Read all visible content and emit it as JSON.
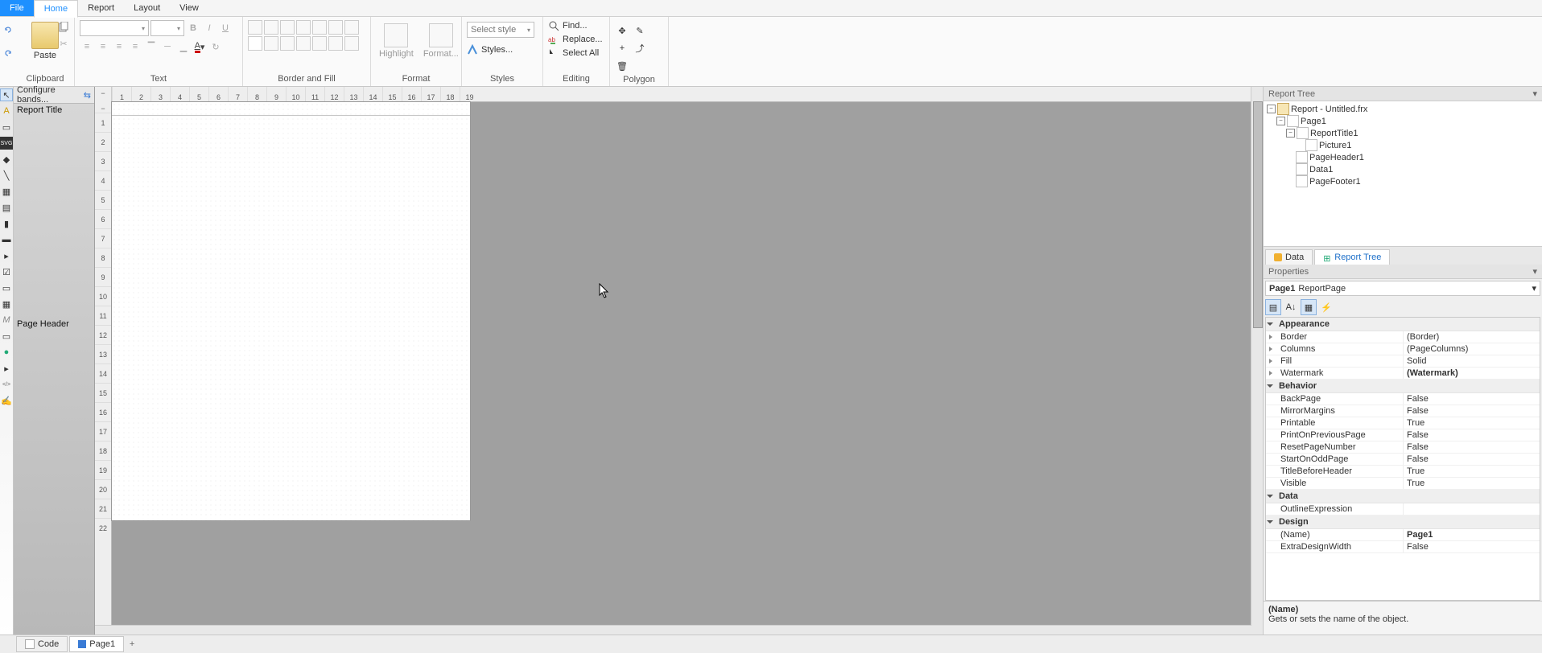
{
  "menu": {
    "file": "File",
    "home": "Home",
    "report": "Report",
    "layout": "Layout",
    "view": "View"
  },
  "ribbon": {
    "clipboard": {
      "paste": "Paste",
      "label": "Clipboard"
    },
    "text": {
      "label": "Text"
    },
    "border": {
      "label": "Border and Fill"
    },
    "format": {
      "highlight": "Highlight",
      "format": "Format...",
      "label": "Format"
    },
    "styles": {
      "combo": "Select style",
      "styles": "Styles...",
      "label": "Styles"
    },
    "editing": {
      "find": "Find...",
      "replace": "Replace...",
      "selectall": "Select All",
      "label": "Editing"
    },
    "polygon": {
      "label": "Polygon"
    }
  },
  "bands": {
    "configure": "Configure bands...",
    "title": "Report Title",
    "header": "Page Header"
  },
  "ruler_h": [
    "1",
    "2",
    "3",
    "4",
    "5",
    "6",
    "7",
    "8",
    "9",
    "10",
    "11",
    "12",
    "13",
    "14",
    "15",
    "16",
    "17",
    "18",
    "19"
  ],
  "ruler_v": [
    "1",
    "2",
    "3",
    "4",
    "5",
    "6",
    "7",
    "8",
    "9",
    "10",
    "11",
    "12",
    "13",
    "14",
    "15",
    "16",
    "17",
    "18",
    "19",
    "20",
    "21",
    "22"
  ],
  "right": {
    "treeTitle": "Report Tree",
    "tree": {
      "root": "Report - Untitled.frx",
      "page": "Page1",
      "items": [
        "ReportTitle1",
        "Picture1",
        "PageHeader1",
        "Data1",
        "PageFooter1"
      ]
    },
    "tabs": {
      "data": "Data",
      "reportTree": "Report Tree"
    },
    "propsTitle": "Properties",
    "object": {
      "name": "Page1",
      "type": "ReportPage"
    },
    "groups": [
      {
        "name": "Appearance",
        "rows": [
          {
            "k": "Border",
            "v": "(Border)",
            "exp": true
          },
          {
            "k": "Columns",
            "v": "(PageColumns)",
            "exp": true
          },
          {
            "k": "Fill",
            "v": "Solid",
            "exp": true
          },
          {
            "k": "Watermark",
            "v": "(Watermark)",
            "exp": true,
            "bold": true
          }
        ]
      },
      {
        "name": "Behavior",
        "rows": [
          {
            "k": "BackPage",
            "v": "False"
          },
          {
            "k": "MirrorMargins",
            "v": "False"
          },
          {
            "k": "Printable",
            "v": "True"
          },
          {
            "k": "PrintOnPreviousPage",
            "v": "False"
          },
          {
            "k": "ResetPageNumber",
            "v": "False"
          },
          {
            "k": "StartOnOddPage",
            "v": "False"
          },
          {
            "k": "TitleBeforeHeader",
            "v": "True"
          },
          {
            "k": "Visible",
            "v": "True"
          }
        ]
      },
      {
        "name": "Data",
        "rows": [
          {
            "k": "OutlineExpression",
            "v": ""
          }
        ]
      },
      {
        "name": "Design",
        "rows": [
          {
            "k": "(Name)",
            "v": "Page1",
            "bold": true
          },
          {
            "k": "ExtraDesignWidth",
            "v": "False"
          }
        ]
      }
    ],
    "desc": {
      "name": "(Name)",
      "text": "Gets or sets the name of the object."
    }
  },
  "bottom": {
    "code": "Code",
    "page": "Page1"
  }
}
